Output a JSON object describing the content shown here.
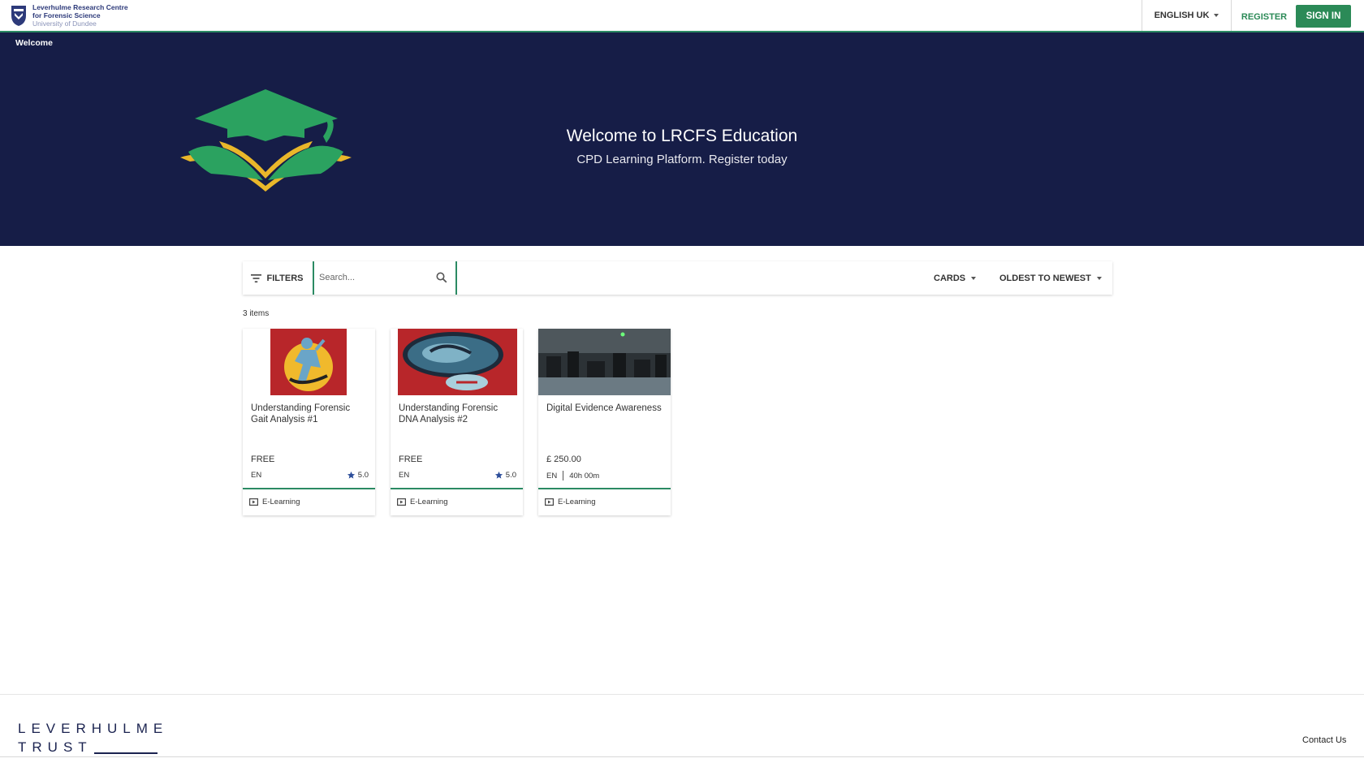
{
  "header": {
    "logo_line1": "Leverhulme Research Centre",
    "logo_line2": "for Forensic Science",
    "logo_line3": "University of Dundee",
    "language": "ENGLISH UK",
    "register": "REGISTER",
    "sign_in": "SIGN IN"
  },
  "hero": {
    "breadcrumb": "Welcome",
    "title": "Welcome to LRCFS Education",
    "subtitle": "CPD Learning Platform. Register today"
  },
  "toolbar": {
    "filters": "FILTERS",
    "search_placeholder": "Search...",
    "view": "CARDS",
    "sort": "OLDEST TO NEWEST"
  },
  "items_count": "3 items",
  "cards": [
    {
      "title": "Understanding Forensic Gait Analysis #1",
      "price": "FREE",
      "language": "EN",
      "rating": "5.0",
      "type": "E-Learning"
    },
    {
      "title": "Understanding Forensic DNA Analysis #2",
      "price": "FREE",
      "language": "EN",
      "rating": "5.0",
      "type": "E-Learning"
    },
    {
      "title": "Digital Evidence Awareness",
      "price": "£ 250.00",
      "language": "EN",
      "duration": "40h 00m",
      "type": "E-Learning"
    }
  ],
  "footer": {
    "trust_line1": "LEVERHULME",
    "trust_line2": "TRUST",
    "contact": "Contact Us"
  },
  "colors": {
    "hero_bg": "#161d47",
    "accent_green": "#2b8a57",
    "star_blue": "#2d4e9a"
  }
}
